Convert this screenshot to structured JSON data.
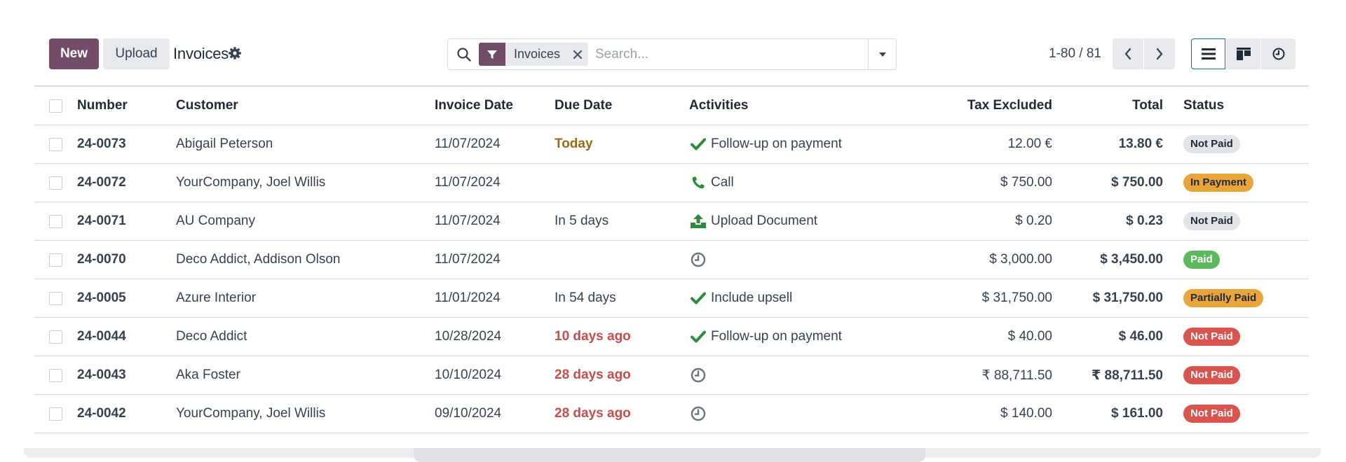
{
  "control_panel": {
    "new_label": "New",
    "upload_label": "Upload",
    "title": "Invoices",
    "search": {
      "facet_label": "Invoices",
      "placeholder": "Search..."
    },
    "pager": {
      "text": "1-80 / 81"
    }
  },
  "columns": {
    "number": "Number",
    "customer": "Customer",
    "invoice_date": "Invoice Date",
    "due_date": "Due Date",
    "activities": "Activities",
    "tax_excluded": "Tax Excluded",
    "total": "Total",
    "status": "Status"
  },
  "rows": [
    {
      "number": "24-0073",
      "customer": "Abigail Peterson",
      "invoice_date": "11/07/2024",
      "due_date": "Today",
      "due_state": "today",
      "activity_icon": "check-icon",
      "activity": "Follow-up on payment",
      "tax_excluded": "12.00 €",
      "total": "13.80 €",
      "status": "Not Paid",
      "status_style": "notpaid"
    },
    {
      "number": "24-0072",
      "customer": "YourCompany, Joel Willis",
      "invoice_date": "11/07/2024",
      "due_date": "",
      "due_state": "none",
      "activity_icon": "phone-icon",
      "activity": "Call",
      "tax_excluded": "$ 750.00",
      "total": "$ 750.00",
      "status": "In Payment",
      "status_style": "inpayment"
    },
    {
      "number": "24-0071",
      "customer": "AU Company",
      "invoice_date": "11/07/2024",
      "due_date": "In 5 days",
      "due_state": "future",
      "activity_icon": "upload-icon",
      "activity": "Upload Document",
      "tax_excluded": "$ 0.20",
      "total": "$ 0.23",
      "status": "Not Paid",
      "status_style": "notpaid"
    },
    {
      "number": "24-0070",
      "customer": "Deco Addict, Addison Olson",
      "invoice_date": "11/07/2024",
      "due_date": "",
      "due_state": "none",
      "activity_icon": "clock-icon",
      "activity": "",
      "tax_excluded": "$ 3,000.00",
      "total": "$ 3,450.00",
      "status": "Paid",
      "status_style": "paid"
    },
    {
      "number": "24-0005",
      "customer": "Azure Interior",
      "invoice_date": "11/01/2024",
      "due_date": "In 54 days",
      "due_state": "future",
      "activity_icon": "check-icon",
      "activity": "Include upsell",
      "tax_excluded": "$ 31,750.00",
      "total": "$ 31,750.00",
      "status": "Partially Paid",
      "status_style": "partial"
    },
    {
      "number": "24-0044",
      "customer": "Deco Addict",
      "invoice_date": "10/28/2024",
      "due_date": "10 days ago",
      "due_state": "late",
      "activity_icon": "check-icon",
      "activity": "Follow-up on payment",
      "tax_excluded": "$ 40.00",
      "total": "$ 46.00",
      "status": "Not Paid",
      "status_style": "notpaid-red"
    },
    {
      "number": "24-0043",
      "customer": "Aka Foster",
      "invoice_date": "10/10/2024",
      "due_date": "28 days ago",
      "due_state": "late",
      "activity_icon": "clock-icon",
      "activity": "",
      "tax_excluded": "₹ 88,711.50",
      "total": "₹ 88,711.50",
      "status": "Not Paid",
      "status_style": "notpaid-red"
    },
    {
      "number": "24-0042",
      "customer": "YourCompany, Joel Willis",
      "invoice_date": "09/10/2024",
      "due_date": "28 days ago",
      "due_state": "late",
      "activity_icon": "clock-icon",
      "activity": "",
      "tax_excluded": "$ 140.00",
      "total": "$ 161.00",
      "status": "Not Paid",
      "status_style": "notpaid-red"
    }
  ],
  "colors": {
    "brand": "#714b67",
    "today": "#9a6b16",
    "late": "#c84c4c",
    "activity_green": "#2e8b3e",
    "icon_grey": "#6b7280"
  }
}
